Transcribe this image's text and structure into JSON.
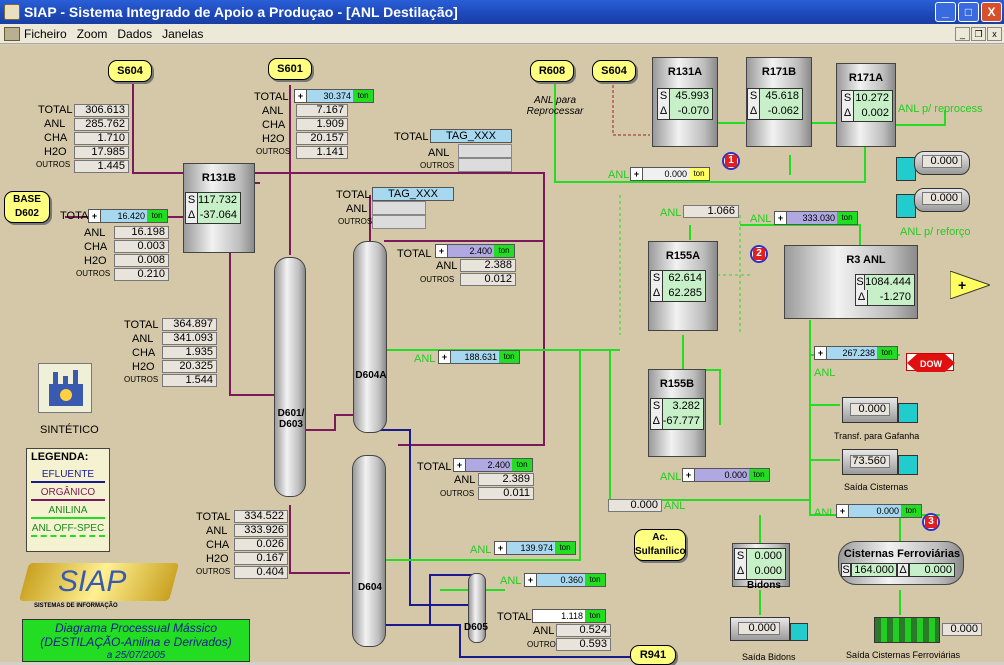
{
  "window": {
    "title": "SIAP - Sistema Integrado de Apoio a Produçao - [ANL Destilação]",
    "minimize": "_",
    "maximize": "□",
    "close": "X"
  },
  "menu": [
    "Ficheiro",
    "Zoom",
    "Dados",
    "Janelas"
  ],
  "tags": {
    "s604a": "S604",
    "s601": "S601",
    "r608": "R608",
    "s604b": "S604",
    "base": "BASE D602",
    "ac": "Ac. Sulfanílico",
    "r941": "R941"
  },
  "texts": {
    "anl_para": "ANL para Reprocessar",
    "anl_reprocess": "ANL p/ reprocess",
    "anl_reforco": "ANL p/ reforço",
    "sintetico": "SINTÉTICO",
    "transf": "Transf. para Gafanha",
    "saida_cisternas": "Saída Cisternas",
    "bidons": "Bidons",
    "saida_bidons": "Saída Bidons",
    "cisternas_ferro": "Cisternas Ferroviárias",
    "saida_ferro": "Saída Cisternas Ferroviárias",
    "siap_logo": "SIAP",
    "siap_sub": "SISTEMAS DE INFORMAÇÃO",
    "diagram_title": "Diagrama Processual Mássico",
    "diagram_sub": "(DESTILAÇÃO-Anilina e Derivados)",
    "diagram_date": "a 25/07/2005",
    "dow": "DOW"
  },
  "left_top": {
    "labels": [
      "TOTAL",
      "ANL",
      "CHA",
      "H2O",
      "OUTROS"
    ],
    "values": [
      "306.613",
      "285.762",
      "1.710",
      "17.985",
      "1.445"
    ]
  },
  "s601_block": {
    "labels": [
      "TOTAL",
      "ANL",
      "CHA",
      "H2O",
      "OUTROS"
    ],
    "values": [
      "30.374",
      "7.167",
      "1.909",
      "20.157",
      "1.141"
    ],
    "unit": "ton"
  },
  "tagxxx1": {
    "labels": [
      "TOTAL",
      "ANL",
      "OUTROS"
    ],
    "name": "TAG_XXX"
  },
  "tagxxx2": {
    "labels": [
      "TOTAL",
      "ANL",
      "OUTROS"
    ],
    "name": "TAG_XXX"
  },
  "base_block": {
    "labels": [
      "TOTAL",
      "ANL",
      "CHA",
      "H2O",
      "OUTROS"
    ],
    "values": [
      "16.420",
      "16.198",
      "0.003",
      "0.008",
      "0.210"
    ],
    "unit": "ton"
  },
  "mid_block": {
    "labels": [
      "TOTAL",
      "ANL",
      "CHA",
      "H2O",
      "OUTROS"
    ],
    "values": [
      "364.897",
      "341.093",
      "1.935",
      "20.325",
      "1.544"
    ]
  },
  "bottom_block": {
    "labels": [
      "TOTAL",
      "ANL",
      "CHA",
      "H2O",
      "OUTROS"
    ],
    "values": [
      "334.522",
      "333.926",
      "0.026",
      "0.167",
      "0.404"
    ]
  },
  "d604a_top": {
    "labels": [
      "TOTAL",
      "ANL",
      "OUTROS"
    ],
    "values": [
      "2.400",
      "2.388",
      "0.012"
    ],
    "unit": "ton"
  },
  "d604_top": {
    "labels": [
      "TOTAL",
      "ANL",
      "OUTROS"
    ],
    "values": [
      "2.400",
      "2.389",
      "0.011"
    ],
    "unit": "ton"
  },
  "d605_block": {
    "labels": [
      "TOTAL",
      "ANL",
      "OUTROS"
    ],
    "values": [
      "1.118",
      "0.524",
      "0.593"
    ],
    "unit": "ton"
  },
  "tanks": {
    "r131b": {
      "name": "R131B",
      "s": "117.732",
      "d": "-37.064"
    },
    "r131a": {
      "name": "R131A",
      "s": "45.993",
      "d": "-0.070"
    },
    "r171b": {
      "name": "R171B",
      "s": "45.618",
      "d": "-0.062"
    },
    "r171a": {
      "name": "R171A",
      "s": "10.272",
      "d": "0.002"
    },
    "r155a": {
      "name": "R155A",
      "s": "62.614",
      "d": "62.285"
    },
    "r155b": {
      "name": "R155B",
      "s": "3.282",
      "d": "-67.777"
    },
    "r3anl": {
      "name": "R3 ANL",
      "s": "1084.444",
      "d": "-1.270"
    },
    "cist": {
      "s": "164.000",
      "d": "0.000"
    },
    "bidons": {
      "s": "0.000",
      "d": "0.000"
    }
  },
  "columns": {
    "d601": "D601/ D603",
    "d604a": "D604A",
    "d604": "D604",
    "d605": "D605"
  },
  "flows": {
    "anl_top": {
      "label": "ANL",
      "value": "0.000",
      "unit": "ton"
    },
    "anl_1066": {
      "label": "ANL",
      "value": "1.066"
    },
    "anl_333": {
      "label": "ANL",
      "value": "333.030",
      "unit": "ton"
    },
    "anl_188": {
      "label": "ANL",
      "value": "188.631",
      "unit": "ton"
    },
    "anl_267": {
      "label": "ANL",
      "value": "267.238",
      "unit": "ton"
    },
    "anl_mid0": {
      "label": "ANL",
      "value": "0.000",
      "unit": "ton"
    },
    "anl_ac": {
      "label": "ANL",
      "value": "0.000"
    },
    "anl_right0": {
      "label": "ANL",
      "value": "0.000",
      "unit": "ton"
    },
    "anl_139": {
      "label": "ANL",
      "value": "139.974",
      "unit": "ton"
    },
    "anl_360": {
      "label": "ANL",
      "value": "0.360",
      "unit": "ton"
    }
  },
  "trucks": {
    "t1": "0.000",
    "t2": "0.000",
    "gafanha": "0.000",
    "cisternas": "73.560",
    "bidons_out": "0.000",
    "ferro_out": "0.000"
  },
  "legend": {
    "title": "LEGENDA:",
    "items": [
      "EFLUENTE",
      "ORGÂNICO",
      "ANILINA",
      "ANL OFF-SPEC"
    ]
  },
  "markers": [
    "1",
    "2",
    "3"
  ],
  "colors": {
    "efluente": "#1a1a90",
    "organico": "#7a1a5a",
    "anilina": "#22dd22",
    "offspec": "#22dd22"
  }
}
